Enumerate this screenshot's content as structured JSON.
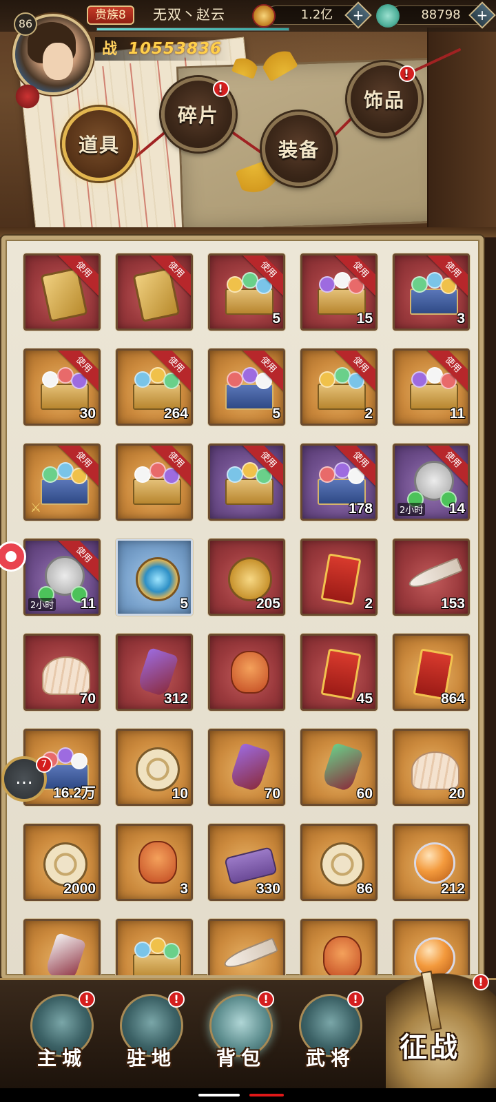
{
  "player": {
    "level": "86",
    "vip": "贵族8",
    "name": "无双丶赵云",
    "power_prefix": "战",
    "power": "10553836"
  },
  "currencies": [
    {
      "icon": "coin-icon",
      "value": "1.2亿",
      "color": "#d9a441"
    },
    {
      "icon": "jade-icon",
      "value": "88798",
      "color": "#4fb09a"
    }
  ],
  "category_tabs": [
    {
      "label": "道具",
      "active": true,
      "badge": false
    },
    {
      "label": "碎片",
      "active": false,
      "badge": true
    },
    {
      "label": "装备",
      "active": false,
      "badge": false
    },
    {
      "label": "饰品",
      "active": false,
      "badge": true
    }
  ],
  "badge_mark": "!",
  "use_label": "使用",
  "items": [
    {
      "quality": "red",
      "icon": "card-icon",
      "count": "",
      "use": true
    },
    {
      "quality": "red",
      "icon": "card-icon",
      "count": "",
      "use": true
    },
    {
      "quality": "red",
      "icon": "chest-icon",
      "count": "5",
      "use": true
    },
    {
      "quality": "red",
      "icon": "chest-icon",
      "count": "15",
      "use": true
    },
    {
      "quality": "red",
      "icon": "chest-icon",
      "count": "3",
      "use": true
    },
    {
      "quality": "orange",
      "icon": "chest-icon",
      "count": "30",
      "use": true
    },
    {
      "quality": "orange",
      "icon": "chest-icon",
      "count": "264",
      "use": true
    },
    {
      "quality": "orange",
      "icon": "chest-icon",
      "count": "5",
      "use": true
    },
    {
      "quality": "orange",
      "icon": "chest-icon",
      "count": "2",
      "use": true
    },
    {
      "quality": "orange",
      "icon": "chest-icon",
      "count": "11",
      "use": true
    },
    {
      "quality": "orange",
      "icon": "chest-icon",
      "count": "",
      "use": true,
      "sword": true
    },
    {
      "quality": "orange",
      "icon": "chest-icon",
      "count": "",
      "use": true
    },
    {
      "quality": "purple",
      "icon": "chest-icon",
      "count": "",
      "use": true
    },
    {
      "quality": "purple",
      "icon": "chest-icon",
      "count": "178",
      "use": true
    },
    {
      "quality": "purple",
      "icon": "clock-icon",
      "count": "14",
      "use": true,
      "timer": "2小时"
    },
    {
      "quality": "purple",
      "icon": "clock-icon",
      "count": "11",
      "use": true,
      "timer": "2小时"
    },
    {
      "quality": "blue",
      "icon": "crest-icon",
      "count": "5",
      "use": false
    },
    {
      "quality": "red",
      "icon": "coin-icon",
      "count": "205",
      "use": false
    },
    {
      "quality": "red",
      "icon": "book-icon",
      "count": "2",
      "use": false
    },
    {
      "quality": "red",
      "icon": "horn-icon",
      "count": "153",
      "use": false
    },
    {
      "quality": "red",
      "icon": "shell-icon",
      "count": "70",
      "use": false
    },
    {
      "quality": "red",
      "icon": "gem-icon",
      "count": "312",
      "use": false
    },
    {
      "quality": "red",
      "icon": "bag-icon",
      "count": "",
      "use": false
    },
    {
      "quality": "red",
      "icon": "book-icon",
      "count": "45",
      "use": false
    },
    {
      "quality": "orange",
      "icon": "book-icon",
      "count": "864",
      "use": false
    },
    {
      "quality": "orange",
      "icon": "chest-icon",
      "count": "16.2万",
      "use": false
    },
    {
      "quality": "orange",
      "icon": "disc-icon",
      "count": "10",
      "use": false
    },
    {
      "quality": "orange",
      "icon": "gem-icon",
      "count": "70",
      "use": false
    },
    {
      "quality": "orange",
      "icon": "gem-icon",
      "count": "60",
      "use": false
    },
    {
      "quality": "orange",
      "icon": "shell-icon",
      "count": "20",
      "use": false
    },
    {
      "quality": "orange",
      "icon": "disc-icon",
      "count": "2000",
      "use": false
    },
    {
      "quality": "orange",
      "icon": "bag-icon",
      "count": "3",
      "use": false
    },
    {
      "quality": "orange",
      "icon": "scroll-icon",
      "count": "330",
      "use": false
    },
    {
      "quality": "orange",
      "icon": "disc-icon",
      "count": "86",
      "use": false
    },
    {
      "quality": "orange",
      "icon": "ball-icon",
      "count": "212",
      "use": false
    },
    {
      "quality": "orange",
      "icon": "gem-icon",
      "count": "",
      "use": false
    },
    {
      "quality": "orange",
      "icon": "chest-icon",
      "count": "",
      "use": false
    },
    {
      "quality": "orange",
      "icon": "horn-icon",
      "count": "",
      "use": false
    },
    {
      "quality": "orange",
      "icon": "bag-icon",
      "count": "",
      "use": false
    },
    {
      "quality": "orange",
      "icon": "ball-icon",
      "count": "",
      "use": false
    }
  ],
  "quality_colors": {
    "red": "#9b3a3d",
    "orange": "#cc8a3d",
    "purple": "#6f4f8d",
    "blue": "#7aa3cd"
  },
  "side": {
    "chat_badge": "7"
  },
  "bottom_nav": [
    {
      "label": "主城",
      "badge": true,
      "active": false
    },
    {
      "label": "驻地",
      "badge": true,
      "active": false
    },
    {
      "label": "背包",
      "badge": true,
      "active": true
    },
    {
      "label": "武将",
      "badge": true,
      "active": false
    }
  ],
  "battle": {
    "label": "征战",
    "badge": true
  }
}
